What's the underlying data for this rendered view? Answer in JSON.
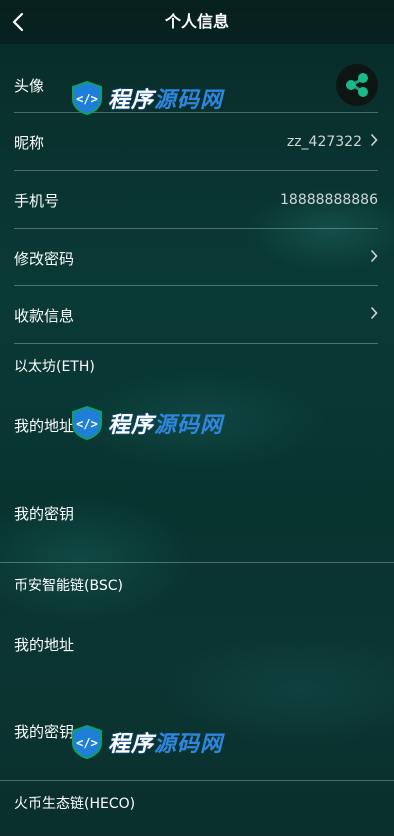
{
  "header": {
    "title": "个人信息"
  },
  "profile": {
    "avatar_label": "头像",
    "nickname_label": "昵称",
    "nickname_value": "zz_427322",
    "phone_label": "手机号",
    "phone_value": "18888888886",
    "change_password_label": "修改密码",
    "payment_info_label": "收款信息"
  },
  "sections": [
    {
      "title": "以太坊(ETH)",
      "address_label": "我的地址",
      "key_label": "我的密钥"
    },
    {
      "title": "币安智能链(BSC)",
      "address_label": "我的地址",
      "key_label": "我的密钥"
    },
    {
      "title": "火币生态链(HECO)"
    }
  ],
  "watermark": {
    "part1": "程序",
    "part2": "源码网"
  }
}
